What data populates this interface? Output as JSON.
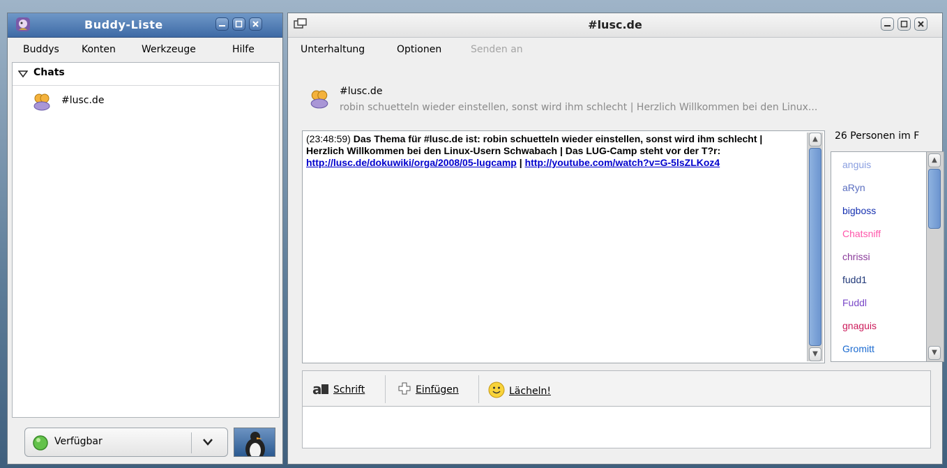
{
  "buddy_window": {
    "title": "Buddy-Liste",
    "menu": [
      "Buddys",
      "Konten",
      "Werkzeuge",
      "Hilfe"
    ],
    "group": "Chats",
    "chat_item": "#lusc.de",
    "status": "Verfügbar"
  },
  "chat_window": {
    "title": "#lusc.de",
    "menu": [
      "Unterhaltung",
      "Optionen",
      "Senden an"
    ],
    "header_name": "#lusc.de",
    "header_topic": "robin schuetteln wieder einstellen, sonst wird ihm schlecht | Herzlich Willkommen bei den Linux...",
    "message": {
      "timestamp": "(23:48:59)",
      "text": "Das Thema für #lusc.de ist: robin schuetteln wieder einstellen, sonst wird ihm schlecht | Herzlich Willkommen bei den Linux-Usern Schwabach | Das LUG-Camp steht vor der T?r:",
      "link1": "http://lusc.de/dokuwiki/orga/2008/05-lugcamp",
      "separator": "|",
      "link2": "http://youtube.com/watch?v=G-5lsZLKoz4"
    },
    "users_label": "26 Personen im F",
    "users": [
      {
        "name": "anguis",
        "color": "#8a9fe0"
      },
      {
        "name": "aRyn",
        "color": "#5a6ec0"
      },
      {
        "name": "bigboss",
        "color": "#1530b0"
      },
      {
        "name": "Chatsniff",
        "color": "#ff55aa"
      },
      {
        "name": "chrissi",
        "color": "#8a3a9a"
      },
      {
        "name": "fudd1",
        "color": "#203878"
      },
      {
        "name": "Fuddl",
        "color": "#7a48c8"
      },
      {
        "name": "gnaguis",
        "color": "#cc1a5a"
      },
      {
        "name": "Gromitt",
        "color": "#1a6ad0"
      }
    ],
    "toolbar": {
      "font": "Schrift",
      "insert": "Einfügen",
      "smile": "Lächeln!"
    }
  }
}
